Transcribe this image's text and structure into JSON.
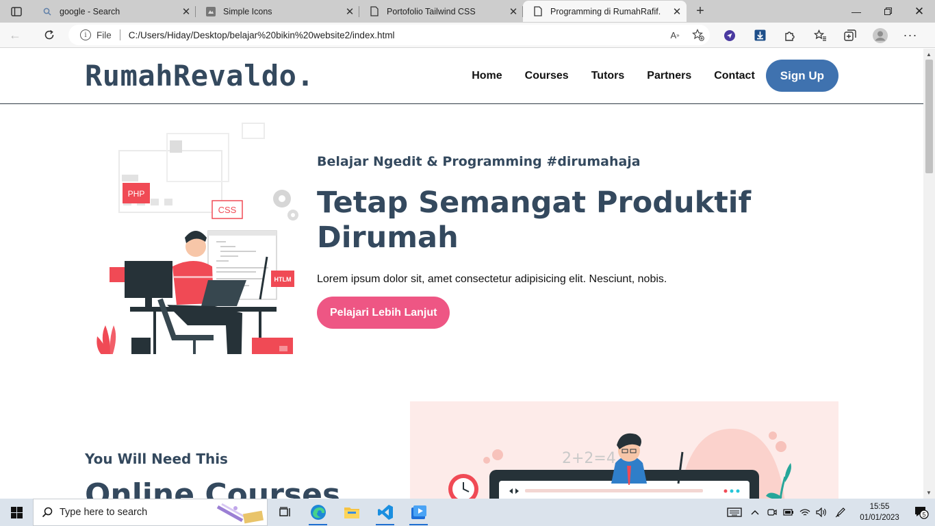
{
  "browser": {
    "tabs": [
      {
        "title": "google - Search",
        "icon": "search-icon"
      },
      {
        "title": "Simple Icons",
        "icon": "simple-icons-favicon"
      },
      {
        "title": "Portofolio Tailwind CSS",
        "icon": "page-icon"
      },
      {
        "title": "Programming di RumahRafif.",
        "icon": "page-icon",
        "active": true
      }
    ],
    "address": {
      "scheme_label": "File",
      "url": "C:/Users/Hiday/Desktop/belajar%20bikin%20website2/index.html"
    }
  },
  "site": {
    "brand": "RumahRevaldo.",
    "nav": {
      "home": "Home",
      "courses": "Courses",
      "tutors": "Tutors",
      "partners": "Partners",
      "contact": "Contact",
      "signup": "Sign Up"
    },
    "hero": {
      "subtitle": "Belajar Ngedit & Programming #dirumahaja",
      "title": "Tetap Semangat Produktif Dirumah",
      "text": "Lorem ipsum dolor sit, amet consectetur adipisicing elit. Nesciunt, nobis.",
      "button": "Pelajari Lebih Lanjut",
      "illustration_labels": {
        "php": "PHP",
        "css": "CSS",
        "html": "HTLM"
      }
    },
    "section2": {
      "subtitle": "You Will Need This",
      "title": "Online Courses",
      "illustration_label": "2+2=4"
    }
  },
  "colors": {
    "heading": "#34495e",
    "signup_bg": "#3f72af",
    "cta_bg": "#ee5684",
    "accent_red": "#f04a55",
    "illus_bg": "#fdebe9"
  },
  "taskbar": {
    "search_placeholder": "Type here to search",
    "time": "15:55",
    "date": "01/01/2023",
    "notifications": "5"
  }
}
